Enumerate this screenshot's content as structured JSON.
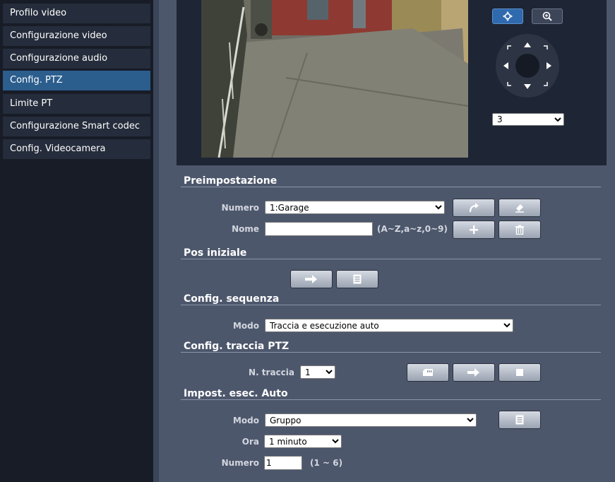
{
  "sidebar": {
    "items": [
      {
        "label": "Profilo video"
      },
      {
        "label": "Configurazione video"
      },
      {
        "label": "Configurazione audio"
      },
      {
        "label": "Config. PTZ",
        "active": true
      },
      {
        "label": "Limite PT"
      },
      {
        "label": "Configurazione Smart codec"
      },
      {
        "label": "Config. Videocamera"
      }
    ]
  },
  "ptz": {
    "speed_value": "3",
    "icons": {
      "move": "move-icon",
      "zoom": "zoom-icon"
    }
  },
  "preset": {
    "title": "Preimpostazione",
    "number_label": "Numero",
    "number_value": "1:Garage",
    "name_label": "Nome",
    "name_value": "",
    "name_hint": "(A~Z,a~z,0~9)"
  },
  "home": {
    "title": "Pos iniziale"
  },
  "sequence": {
    "title": "Config. sequenza",
    "mode_label": "Modo",
    "mode_value": "Traccia e esecuzione auto"
  },
  "trace": {
    "title": "Config. traccia PTZ",
    "number_label": "N. traccia",
    "number_value": "1"
  },
  "auto_run": {
    "title": "Impost. esec. Auto",
    "mode_label": "Modo",
    "mode_value": "Gruppo",
    "time_label": "Ora",
    "time_value": "1 minuto",
    "count_label": "Numero",
    "count_value": "1",
    "count_hint": "(1 ~ 6)"
  },
  "colors": {
    "sidebar_active": "#2b5d8d",
    "main_bg": "#4d576c",
    "video_panel_bg": "#1e2534"
  }
}
